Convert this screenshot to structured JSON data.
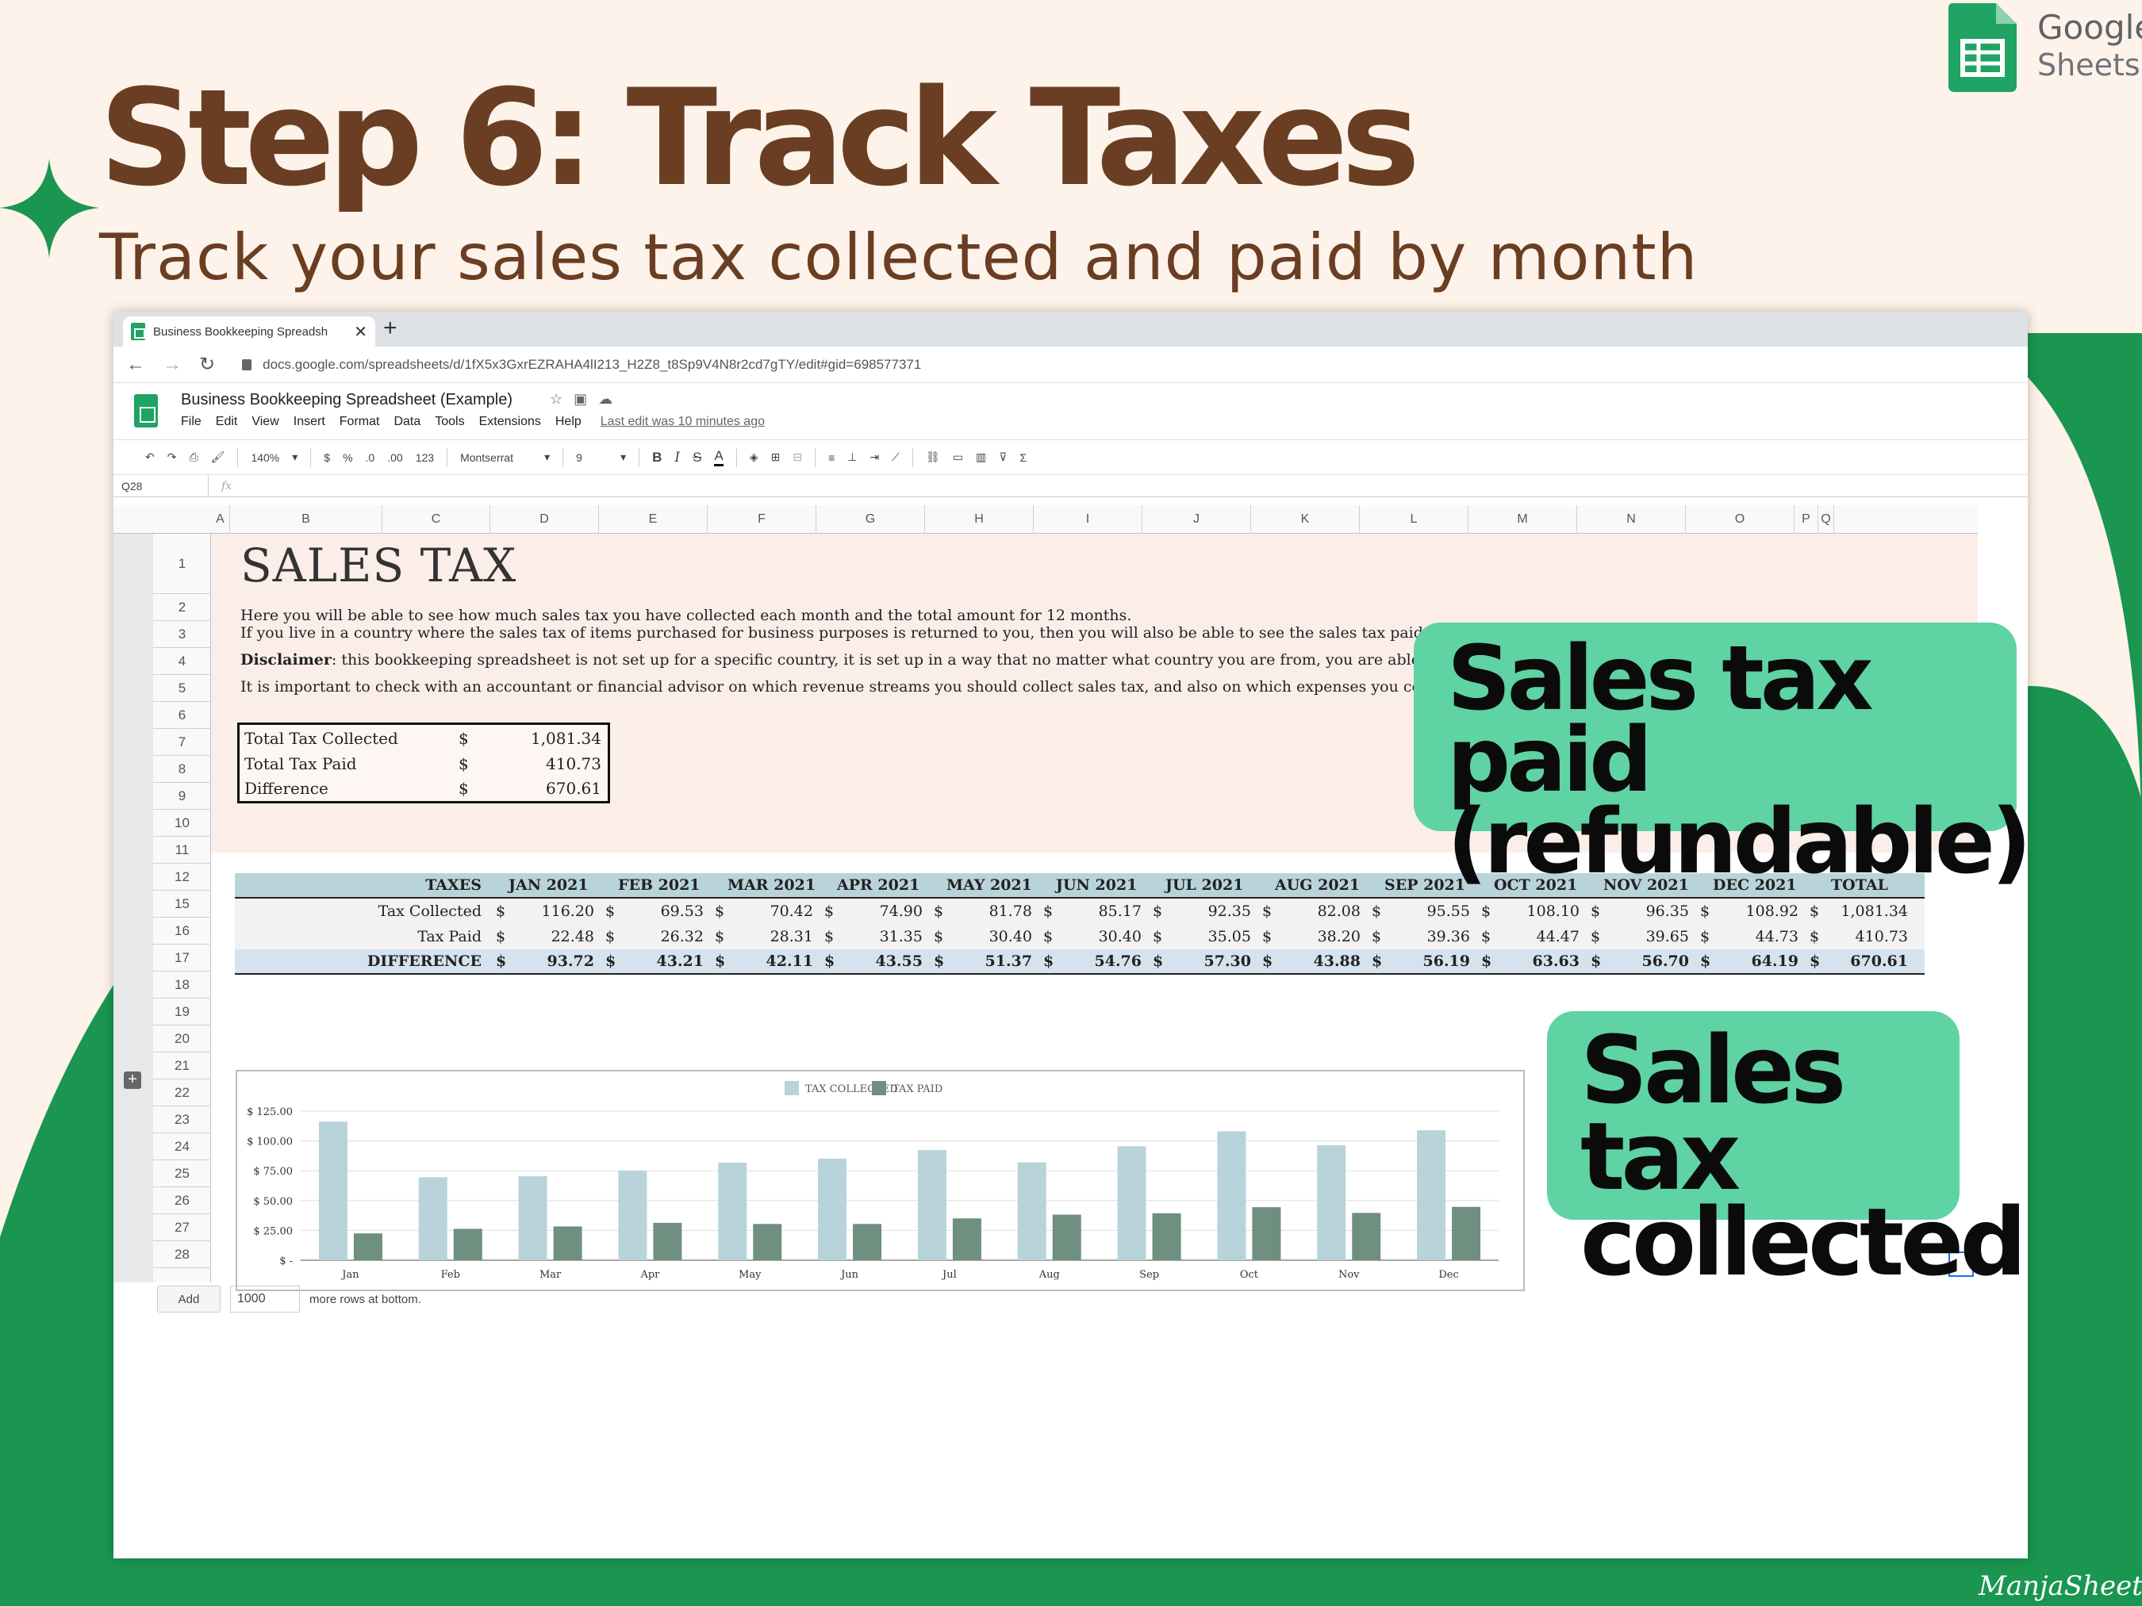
{
  "hero": {
    "title": "Step 6: Track Taxes",
    "subtitle": "Track your sales tax collected and paid by month"
  },
  "branding": {
    "logo_line1": "Google",
    "logo_line2": "Sheets",
    "signature": "ManjaSheets"
  },
  "colors": {
    "brown": "#6a3e22",
    "green": "#1a9650",
    "callout": "#5fd3a4",
    "header_blue": "#b9d3db",
    "bar_collected": "#b9d3db",
    "bar_paid": "#6f8f81"
  },
  "browser": {
    "tab_title": "Business Bookkeeping Spreadsh",
    "url": "docs.google.com/spreadsheets/d/1fX5x3GxrEZRAHA4lI213_H2Z8_t8Sp9V4N8r2cd7gTY/edit#gid=698577371"
  },
  "doc": {
    "title": "Business Bookkeeping Spreadsheet (Example)",
    "menus": [
      "File",
      "Edit",
      "View",
      "Insert",
      "Format",
      "Data",
      "Tools",
      "Extensions",
      "Help"
    ],
    "last_edit": "Last edit was 10 minutes ago"
  },
  "toolbar": {
    "zoom": "140%",
    "currency": "$",
    "percent": "%",
    "dec_less": ".0",
    "dec_more": ".00",
    "number_format": "123",
    "font": "Montserrat",
    "font_size": "9"
  },
  "formula_bar": {
    "cell_ref": "Q28",
    "fx": "fx"
  },
  "columns": [
    "A",
    "B",
    "C",
    "D",
    "E",
    "F",
    "G",
    "H",
    "I",
    "J",
    "K",
    "L",
    "M",
    "N",
    "O",
    "P",
    "Q"
  ],
  "rows": [
    "1",
    "2",
    "3",
    "4",
    "5",
    "6",
    "7",
    "8",
    "9",
    "10",
    "11",
    "12",
    "15",
    "16",
    "17",
    "18",
    "19",
    "20",
    "21",
    "22",
    "23",
    "24",
    "25",
    "26",
    "27",
    "28"
  ],
  "sheet": {
    "title": "SALES TAX",
    "desc1": "Here you will be able to see how much sales tax you have collected each month and the total amount for 12 months.",
    "desc2": "If you live in a country where the sales tax of items purchased for business purposes is returned to you, then you will also be able to see the sales tax paid per month here",
    "disclaimer_label": "Disclaimer",
    "disclaimer_text": ": this bookkeeping spreadsheet is not set up for a specific country, it is set up in a way that no matter what country you are from, you are able to track your i",
    "desc4": "It is important to check with an accountant or financial advisor on which revenue streams you should collect sales tax, and also on which expenses you could possibly g"
  },
  "summary": [
    {
      "label": "Total Tax Collected",
      "currency": "$",
      "value": "1,081.34"
    },
    {
      "label": "Total Tax Paid",
      "currency": "$",
      "value": "410.73"
    },
    {
      "label": "Difference",
      "currency": "$",
      "value": "670.61"
    }
  ],
  "tax_table": {
    "headers": [
      "TAXES",
      "JAN 2021",
      "FEB 2021",
      "MAR 2021",
      "APR 2021",
      "MAY 2021",
      "JUN 2021",
      "JUL 2021",
      "AUG 2021",
      "SEP 2021",
      "OCT 2021",
      "NOV 2021",
      "DEC 2021",
      "TOTAL"
    ],
    "rows": [
      {
        "label": "Tax Collected",
        "values": [
          "116.20",
          "69.53",
          "70.42",
          "74.90",
          "81.78",
          "85.17",
          "92.35",
          "82.08",
          "95.55",
          "108.10",
          "96.35",
          "108.92",
          "1,081.34"
        ]
      },
      {
        "label": "Tax Paid",
        "values": [
          "22.48",
          "26.32",
          "28.31",
          "31.35",
          "30.40",
          "30.40",
          "35.05",
          "38.20",
          "39.36",
          "44.47",
          "39.65",
          "44.73",
          "410.73"
        ]
      },
      {
        "label": "DIFFERENCE",
        "values": [
          "93.72",
          "43.21",
          "42.11",
          "43.55",
          "51.37",
          "54.76",
          "57.30",
          "43.88",
          "56.19",
          "63.63",
          "56.70",
          "64.19",
          "670.61"
        ]
      }
    ],
    "currency": "$"
  },
  "chart_data": {
    "type": "bar",
    "categories": [
      "Jan",
      "Feb",
      "Mar",
      "Apr",
      "May",
      "Jun",
      "Jul",
      "Aug",
      "Sep",
      "Oct",
      "Nov",
      "Dec"
    ],
    "series": [
      {
        "name": "TAX COLLECTED",
        "color": "#b9d3db",
        "values": [
          116.2,
          69.53,
          70.42,
          74.9,
          81.78,
          85.17,
          92.35,
          82.08,
          95.55,
          108.1,
          96.35,
          108.92
        ]
      },
      {
        "name": "TAX PAID",
        "color": "#6f8f81",
        "values": [
          22.48,
          26.32,
          28.31,
          31.35,
          30.4,
          30.4,
          35.05,
          38.2,
          39.36,
          44.47,
          39.65,
          44.73
        ]
      }
    ],
    "yticks": [
      "$ -",
      "$ 25.00",
      "$ 50.00",
      "$ 75.00",
      "$ 100.00",
      "$ 125.00"
    ],
    "ylim": [
      0,
      125
    ],
    "legend": "top-center",
    "grid": true
  },
  "callouts": {
    "paid_line1": "Sales tax paid",
    "paid_line2": "(refundable)",
    "collected_line1": "Sales tax",
    "collected_line2": "collected"
  },
  "footer": {
    "add_label": "Add",
    "add_count": "1000",
    "add_suffix": "more rows at bottom."
  }
}
